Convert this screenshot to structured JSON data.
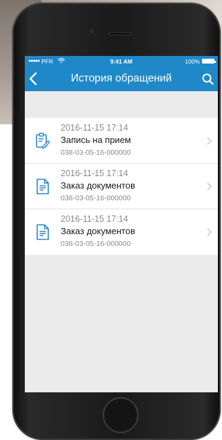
{
  "status_bar": {
    "carrier": "PFR",
    "time": "9:41 AM",
    "battery": "100%"
  },
  "nav": {
    "title": "История обращений",
    "back_icon": "chevron-left-icon",
    "search_icon": "search-icon"
  },
  "items": [
    {
      "date": "2016-11-15 17:14",
      "title": "Запись на прием",
      "number": "038-03-05-16-000000",
      "icon": "clipboard-edit-icon"
    },
    {
      "date": "2016-11-15 17:14",
      "title": "Заказ документов",
      "number": "038-03-05-16-000000",
      "icon": "document-icon"
    },
    {
      "date": "2016-11-15 17:14",
      "title": "Заказ документов",
      "number": "038-03-05-16-000000",
      "icon": "document-icon"
    }
  ],
  "colors": {
    "accent": "#1e88c8",
    "background": "#ebebeb",
    "secondary_text": "#8a8a8a"
  }
}
